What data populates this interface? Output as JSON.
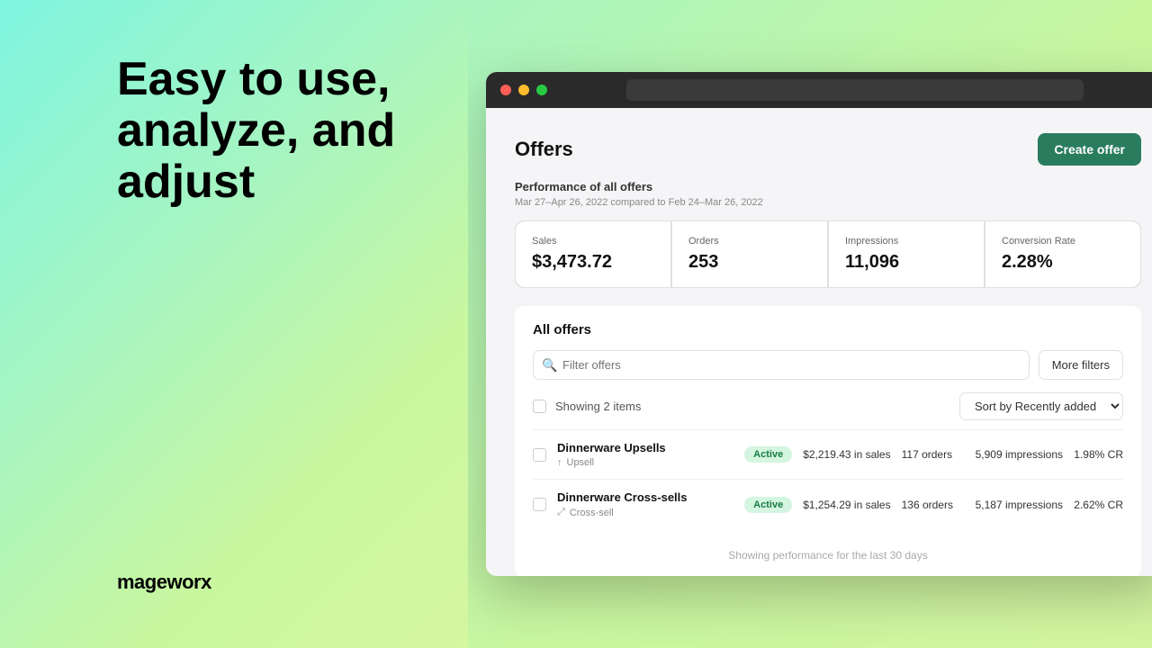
{
  "left": {
    "hero_text": "Easy to use, analyze, and adjust",
    "brand": "mageworx"
  },
  "browser": {
    "titlebar": {
      "traffic_lights": [
        "red",
        "yellow",
        "green"
      ]
    },
    "header": {
      "title": "Offers",
      "create_btn": "Create offer"
    },
    "performance": {
      "label": "Performance of all offers",
      "date_range": "Mar 27–Apr 26, 2022 compared to Feb 24–Mar 26, 2022",
      "stats": [
        {
          "label": "Sales",
          "value": "$3,473.72"
        },
        {
          "label": "Orders",
          "value": "253"
        },
        {
          "label": "Impressions",
          "value": "11,096"
        },
        {
          "label": "Conversion Rate",
          "value": "2.28%"
        }
      ]
    },
    "all_offers": {
      "title": "All offers",
      "search_placeholder": "Filter offers",
      "more_filters_btn": "More filters",
      "showing_text": "Showing 2 items",
      "sort_label": "Sort by Recently added",
      "offers": [
        {
          "name": "Dinnerware Upsells",
          "type": "Upsell",
          "type_icon": "↑",
          "status": "Active",
          "sales": "$2,219.43 in sales",
          "orders": "117 orders",
          "impressions": "5,909 impressions",
          "cr": "1.98% CR"
        },
        {
          "name": "Dinnerware Cross-sells",
          "type": "Cross-sell",
          "type_icon": "⤢",
          "status": "Active",
          "sales": "$1,254.29 in sales",
          "orders": "136 orders",
          "impressions": "5,187 impressions",
          "cr": "2.62% CR"
        }
      ],
      "footer_note": "Showing performance for the last 30 days"
    }
  }
}
